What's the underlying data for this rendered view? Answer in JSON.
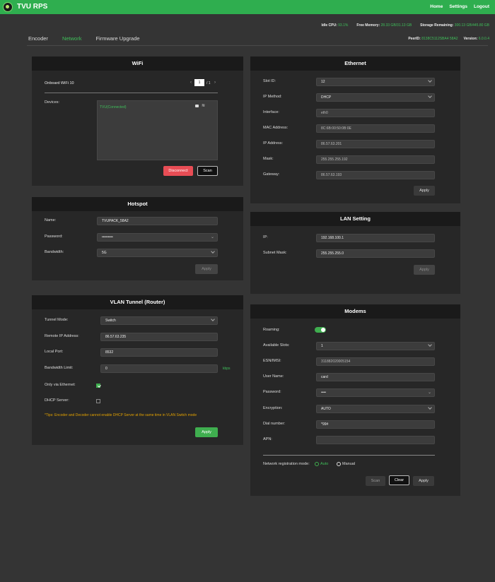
{
  "app": {
    "title": "TVU RPS"
  },
  "nav": {
    "home": "Home",
    "settings": "Settings",
    "logout": "Logout"
  },
  "status": {
    "idle_cpu_label": "Idle CPU:",
    "idle_cpu": "93.1%",
    "free_memory_label": "Free Memory:",
    "free_memory": "28.33 GB/31.13 GB",
    "storage_label": "Storage Remaining:",
    "storage": "300.13 GB/445.80 GB",
    "peer_id_label": "PeerID:",
    "peer_id": "8138C5112SBA4 58A2",
    "version_label": "Version:",
    "version": "6.0.0.4"
  },
  "tabs": [
    "Encoder",
    "Network",
    "Firmware Upgrade"
  ],
  "wifi": {
    "title": "WiFi",
    "onboard_label": "Onboard WiFi 10",
    "page_current": "1",
    "page_total": "/ 1",
    "devices_label": "Devices:",
    "device_name": "TVU(Connected)",
    "disconnect": "Disconnect",
    "scan": "Scan"
  },
  "hotspot": {
    "title": "Hotspot",
    "name_label": "Name:",
    "name_value": "TVUPACK_58A2",
    "password_label": "Password:",
    "password_value": "•••••••••",
    "bandwidth_label": "Bandwidth:",
    "bandwidth_value": "5G",
    "apply": "Apply"
  },
  "vlan": {
    "title": "VLAN Tunnel (Router)",
    "mode_label": "Tunnel Mode:",
    "mode_value": "Switch",
    "remote_ip_label": "Remote IP Address:",
    "remote_ip_value": "86.57.63.235",
    "local_port_label": "Local Port:",
    "local_port_value": "8532",
    "bandwidth_label": "Bandwidth Limit:",
    "bandwidth_value": "0",
    "bandwidth_unit": "kbps",
    "only_ethernet_label": "Only via Ethernet:",
    "dhcp_label": "DHCP Server:",
    "tips": "*Tips: Encoder and Decoder cannot enable DHCP Server at the same time in VLAN Switch mode",
    "apply": "Apply"
  },
  "ethernet": {
    "title": "Ethernet",
    "slot_label": "Slot ID:",
    "slot_value": "12",
    "method_label": "IP Method:",
    "method_value": "DHCP",
    "interface_label": "Interface:",
    "interface_value": "eth0",
    "mac_label": "MAC Address:",
    "mac_value": "8C:6B:00:50:0B:0E",
    "ip_label": "IP Address:",
    "ip_value": "86.57.63.201",
    "mask_label": "Mask:",
    "mask_value": "255.255.255.192",
    "gateway_label": "Gateway:",
    "gateway_value": "86.57.63.193",
    "apply": "Apply"
  },
  "lan": {
    "title": "LAN Setting",
    "ip_label": "IP:",
    "ip_value": "192.168.100.1",
    "mask_label": "Subnet Mask:",
    "mask_value": "255.255.255.0",
    "apply": "Apply"
  },
  "modems": {
    "title": "Modems",
    "roaming_label": "Roaming:",
    "slots_label": "Available Slots:",
    "slots_value": "1",
    "esn_label": "ESN/IMSI:",
    "esn_value": "311882020005154",
    "user_label": "User Name:",
    "user_value": "card",
    "password_label": "Password:",
    "password_value": "••••",
    "encryption_label": "Encryption:",
    "encryption_value": "AUTO",
    "dial_label": "Dial number:",
    "dial_value": "*99#",
    "apn_label": "APN:",
    "apn_value": "",
    "reg_label": "Network registration mode:",
    "reg_auto": "Auto",
    "reg_manual": "Manual",
    "scan": "Scan",
    "clear": "Clear",
    "apply": "Apply"
  },
  "colors": {
    "accent": "#3fae4f",
    "topbar": "#2fae4f",
    "danger": "#e84d55",
    "tips": "#e0a000"
  }
}
